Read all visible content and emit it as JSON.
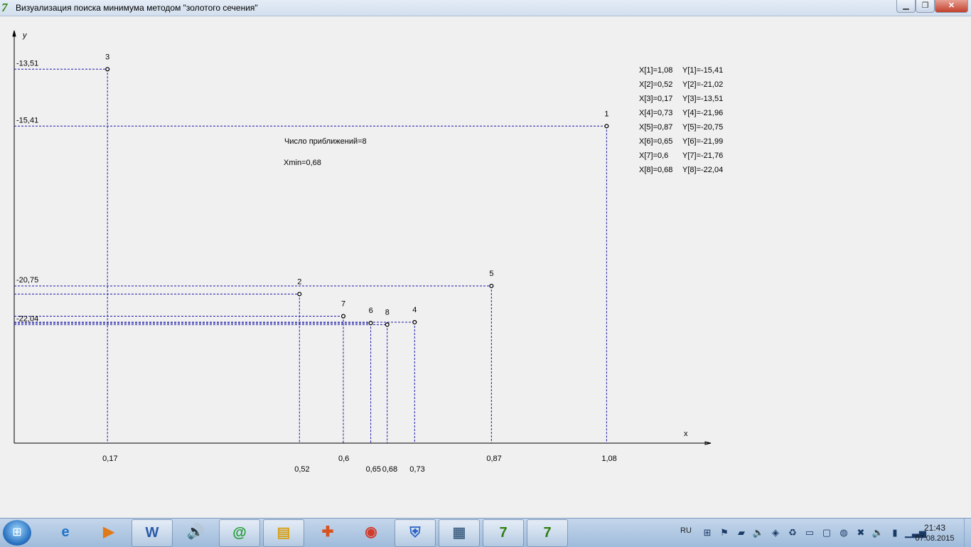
{
  "window": {
    "title": "Визуализация поиска минимума методом \"золотого сечения\"",
    "app_icon_glyph": "7",
    "controls": {
      "minimize": "▁",
      "maximize": "❐",
      "close": "✕"
    }
  },
  "chart_data": {
    "type": "scatter",
    "xlabel": "x",
    "ylabel": "y",
    "xlim": [
      0.0,
      1.27
    ],
    "ylim": [
      -26.0,
      -12.22
    ],
    "points": [
      {
        "n": "1",
        "x": 1.08,
        "y": -15.41
      },
      {
        "n": "2",
        "x": 0.52,
        "y": -21.02
      },
      {
        "n": "3",
        "x": 0.17,
        "y": -13.51
      },
      {
        "n": "4",
        "x": 0.73,
        "y": -21.96
      },
      {
        "n": "5",
        "x": 0.87,
        "y": -20.75
      },
      {
        "n": "6",
        "x": 0.65,
        "y": -21.99
      },
      {
        "n": "7",
        "x": 0.6,
        "y": -21.76
      },
      {
        "n": "8",
        "x": 0.68,
        "y": -22.04
      }
    ],
    "x_tick_labels": [
      {
        "text": "0,17",
        "x": 0.17,
        "row": 0
      },
      {
        "text": "0,52",
        "x": 0.52,
        "row": 1
      },
      {
        "text": "0,6",
        "x": 0.6,
        "row": 0
      },
      {
        "text": "0,65",
        "x": 0.65,
        "row": 1
      },
      {
        "text": "0,68",
        "x": 0.68,
        "row": 1
      },
      {
        "text": "0,73",
        "x": 0.73,
        "row": 1
      },
      {
        "text": "0,87",
        "x": 0.87,
        "row": 0
      },
      {
        "text": "1,08",
        "x": 1.08,
        "row": 0
      }
    ],
    "y_tick_labels": [
      {
        "text": "-13,51",
        "y": -13.51
      },
      {
        "text": "-15,41",
        "y": -15.41
      },
      {
        "text": "-20,75",
        "y": -20.75
      },
      {
        "text": "-22,04",
        "y": -22.04
      }
    ],
    "annotations": {
      "iterations": "Число приближений=8",
      "xmin": "Xmin=0,68"
    },
    "legend": [
      {
        "x": "X[1]=1,08",
        "y": "Y[1]=-15,41"
      },
      {
        "x": "X[2]=0,52",
        "y": "Y[2]=-21,02"
      },
      {
        "x": "X[3]=0,17",
        "y": "Y[3]=-13,51"
      },
      {
        "x": "X[4]=0,73",
        "y": "Y[4]=-21,96"
      },
      {
        "x": "X[5]=0,87",
        "y": "Y[5]=-20,75"
      },
      {
        "x": "X[6]=0,65",
        "y": "Y[6]=-21,99"
      },
      {
        "x": "X[7]=0,6",
        "y": "Y[7]=-21,76"
      },
      {
        "x": "X[8]=0,68",
        "y": "Y[8]=-22,04"
      }
    ],
    "legend_placement": "top-right",
    "guide_color": "#1a1aa6",
    "grid": false
  },
  "taskbar": {
    "start_glyph": "⊞",
    "items": [
      {
        "name": "ie-icon",
        "glyph": "e",
        "color": "#1e73c8",
        "open": false
      },
      {
        "name": "media-player-icon",
        "glyph": "▶",
        "color": "#e07a16",
        "open": false
      },
      {
        "name": "word-icon",
        "glyph": "W",
        "color": "#2a5aa8",
        "open": true
      },
      {
        "name": "speaker-app-icon",
        "glyph": "🔊",
        "color": "#3a64a0",
        "open": false
      },
      {
        "name": "mail-agent-icon",
        "glyph": "@",
        "color": "#1f9a2e",
        "open": true
      },
      {
        "name": "file-explorer-icon",
        "glyph": "▤",
        "color": "#d6a21e",
        "open": true
      },
      {
        "name": "puzzle-app-icon",
        "glyph": "✚",
        "color": "#d8521e",
        "open": false
      },
      {
        "name": "chrome-icon",
        "glyph": "◉",
        "color": "#d23a2a",
        "open": false
      },
      {
        "name": "security-shield-icon",
        "glyph": "⛨",
        "color": "#2a62c4",
        "open": true
      },
      {
        "name": "calculator-icon",
        "glyph": "▦",
        "color": "#4a6a8a",
        "open": true
      },
      {
        "name": "delphi-ide-icon",
        "glyph": "7",
        "color": "#2e7d12",
        "open": true
      },
      {
        "name": "delphi-app-icon",
        "glyph": "7",
        "color": "#2e7d12",
        "open": true
      }
    ],
    "language": "RU",
    "tray_icons": [
      {
        "name": "windows-flag-tray-icon",
        "glyph": "⊞"
      },
      {
        "name": "action-center-flag-icon",
        "glyph": "⚑"
      },
      {
        "name": "hardware-tray-icon",
        "glyph": "▰"
      },
      {
        "name": "volume-tray-icon",
        "glyph": "🔈"
      },
      {
        "name": "network-adapter-tray-icon",
        "glyph": "◈"
      },
      {
        "name": "sync-tray-icon",
        "glyph": "♻"
      },
      {
        "name": "display-tray-icon",
        "glyph": "▭"
      },
      {
        "name": "monitor-tray-icon",
        "glyph": "▢"
      },
      {
        "name": "antivirus-tray-icon",
        "glyph": "◍"
      },
      {
        "name": "blocked-tray-icon",
        "glyph": "✖"
      },
      {
        "name": "speaker-tray-icon",
        "glyph": "🔉"
      },
      {
        "name": "usb-tray-icon",
        "glyph": "▮"
      },
      {
        "name": "signal-strength-tray-icon",
        "glyph": "▁▃▅"
      }
    ],
    "time": "21:43",
    "date": "07.08.2015"
  }
}
